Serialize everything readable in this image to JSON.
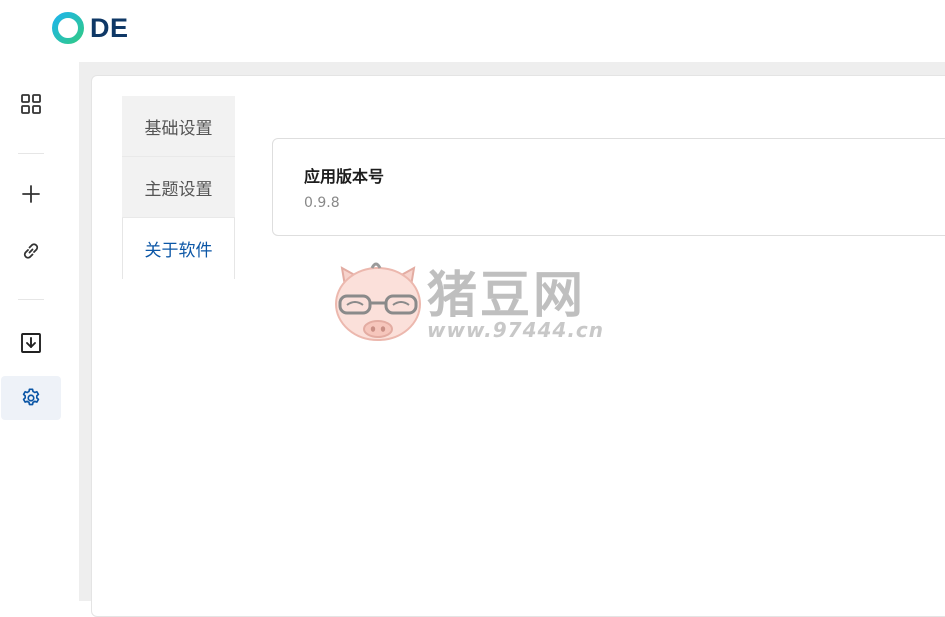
{
  "app": {
    "logo_text": "DE"
  },
  "sidebar": {
    "items": [
      {
        "name": "dashboard",
        "icon": "grid-icon",
        "active": false
      },
      {
        "name": "add",
        "icon": "plus-icon",
        "active": false
      },
      {
        "name": "link",
        "icon": "link-icon",
        "active": false
      },
      {
        "name": "download",
        "icon": "download-icon",
        "active": false
      },
      {
        "name": "settings",
        "icon": "gear-icon",
        "active": true
      }
    ]
  },
  "settings": {
    "tabs": [
      {
        "label": "基础设置",
        "active": false
      },
      {
        "label": "主题设置",
        "active": false
      },
      {
        "label": "关于软件",
        "active": true
      }
    ],
    "about": {
      "version_title": "应用版本号",
      "version_value": "0.9.8"
    }
  },
  "watermark": {
    "brand": "猪豆网",
    "url": "www.97444.cn"
  },
  "colors": {
    "accent": "#0b56a6",
    "logo_dark": "#0f3866",
    "logo_ring_start": "#1fb5e8",
    "logo_ring_end": "#2fc98a"
  }
}
